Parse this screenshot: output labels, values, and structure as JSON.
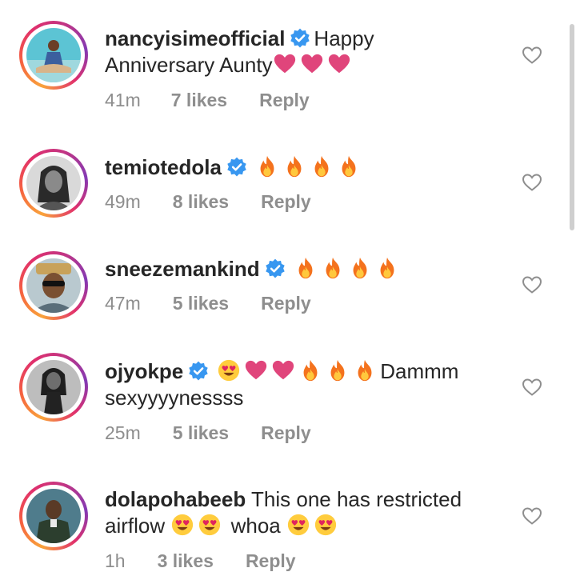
{
  "comments": [
    {
      "username": "nancyisimeofficial",
      "verified": true,
      "text_parts": [
        "Happy",
        "Anniversary Aunty"
      ],
      "emojis_after": [
        "heart",
        "heart",
        "heart"
      ],
      "time": "41m",
      "likes": "7 likes",
      "reply": "Reply"
    },
    {
      "username": "temiotedola",
      "verified": true,
      "emojis_after": [
        "fire",
        "fire",
        "fire",
        "fire"
      ],
      "time": "49m",
      "likes": "8 likes",
      "reply": "Reply"
    },
    {
      "username": "sneezemankind",
      "verified": true,
      "emojis_after": [
        "fire",
        "fire",
        "fire",
        "fire"
      ],
      "time": "47m",
      "likes": "5 likes",
      "reply": "Reply"
    },
    {
      "username": "ojyokpe",
      "verified": true,
      "emojis_before": [
        "heart-eyes",
        "heart",
        "heart",
        "fire",
        "fire",
        "fire"
      ],
      "text_parts": [
        "Dammm",
        "sexyyyynessss"
      ],
      "time": "25m",
      "likes": "5 likes",
      "reply": "Reply"
    },
    {
      "username": "dolapohabeeb",
      "verified": false,
      "text_parts": [
        "This one has restricted",
        "airflow",
        "whoa"
      ],
      "emojis_mid": [
        "heart-eyes",
        "heart-eyes"
      ],
      "emojis_after": [
        "heart-eyes",
        "heart-eyes"
      ],
      "time": "1h",
      "likes": "3 likes",
      "reply": "Reply"
    }
  ],
  "icons": {
    "like": "heart-outline-icon",
    "verified": "verified-badge-icon"
  },
  "colors": {
    "verified_blue": "#3897f0",
    "meta_gray": "#8e8e8e",
    "text": "#262626",
    "heart_pink": "#e0457b",
    "fire_orange": "#f4721d"
  }
}
